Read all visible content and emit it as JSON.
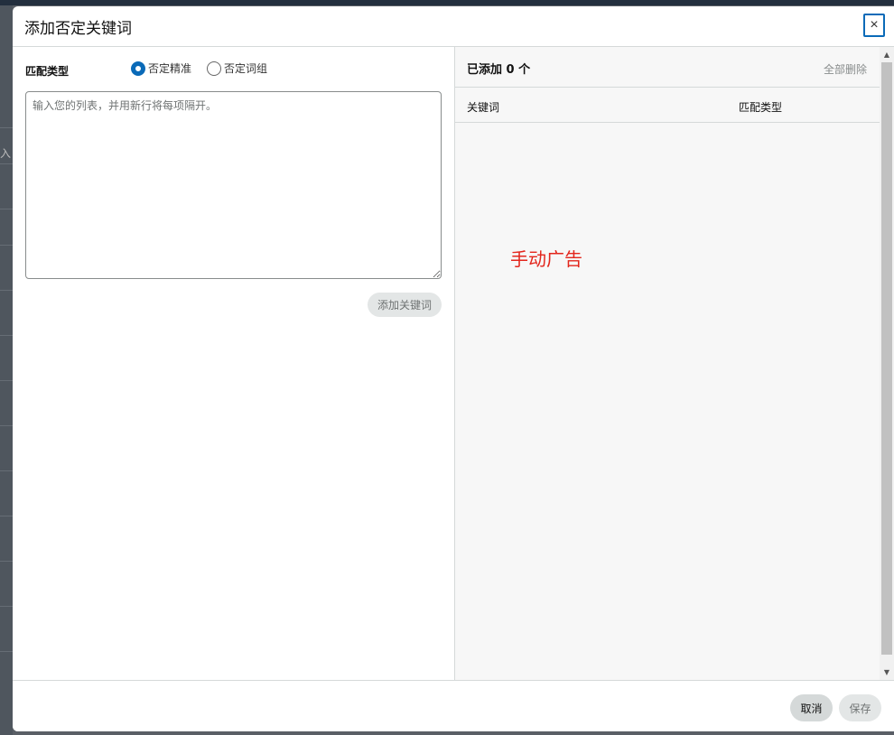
{
  "modal": {
    "title": "添加否定关键词",
    "close_icon": "×"
  },
  "left_panel": {
    "match_type_label": "匹配类型",
    "radio_options": [
      {
        "label": "否定精准",
        "checked": true
      },
      {
        "label": "否定词组",
        "checked": false
      }
    ],
    "textarea_placeholder": "输入您的列表，并用新行将每项隔开。",
    "add_keyword_button": "添加关键词"
  },
  "right_panel": {
    "added_count": "已添加 0 个",
    "delete_all": "全部删除",
    "columns": [
      "关键词",
      "匹配类型"
    ],
    "annotation": "手动广告"
  },
  "footer": {
    "cancel": "取消",
    "save": "保存"
  },
  "background": {
    "partial_glyph": "入"
  },
  "colors": {
    "accent": "#0a6ab8",
    "annotation": "#e3261c"
  }
}
